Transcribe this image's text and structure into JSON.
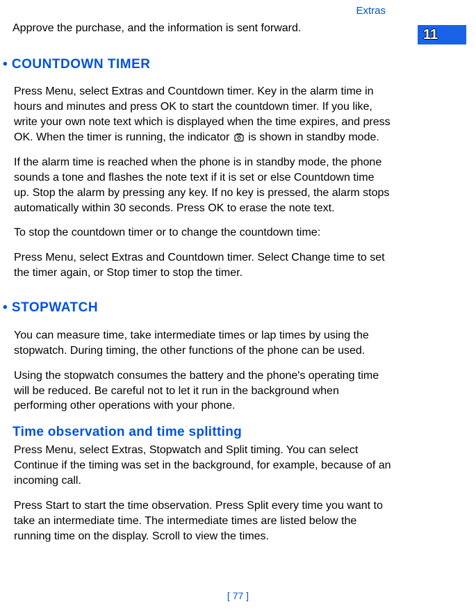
{
  "header": {
    "section_label": "Extras",
    "chapter_number": "11"
  },
  "intro": "Approve the purchase, and the information is sent forward.",
  "section_countdown": {
    "heading": "•  COUNTDOWN TIMER",
    "p1_a": "Press Menu, select Extras and Countdown timer. Key in the alarm time in hours and minutes and press OK to start the countdown timer. If you like, write your own note text which is displayed when the time expires, and press OK. When the timer is running, the indicator ",
    "p1_b": " is shown in standby mode.",
    "p2": "If the alarm time is reached when the phone is in standby mode, the phone sounds a tone and flashes the note text if it is set or else Countdown time up. Stop the alarm by pressing any key. If no key is pressed, the alarm stops automatically within 30 seconds. Press OK to erase the note text.",
    "p3": "To stop the countdown timer or to change the countdown time:",
    "p4": "Press Menu, select Extras and Countdown timer. Select Change time to set the timer again, or Stop timer to stop the timer."
  },
  "section_stopwatch": {
    "heading": "•  STOPWATCH",
    "p1": "You can measure time, take intermediate times or lap times by using the stopwatch. During timing, the other functions of the phone can be used.",
    "p2": "Using the stopwatch consumes the battery and the phone's operating time will be reduced. Be careful not to let it run in the background when performing other operations with your phone.",
    "subheading": "Time observation and time splitting",
    "p3": "Press Menu, select Extras, Stopwatch and Split timing. You can select Continue if the timing was set in the background, for example, because of an incoming call.",
    "p4": "Press Start to start the time observation. Press Split every time you want to take an intermediate time. The intermediate times are listed below the running time on the display. Scroll to view the times."
  },
  "footer": {
    "page_label": "[ 77 ]"
  }
}
